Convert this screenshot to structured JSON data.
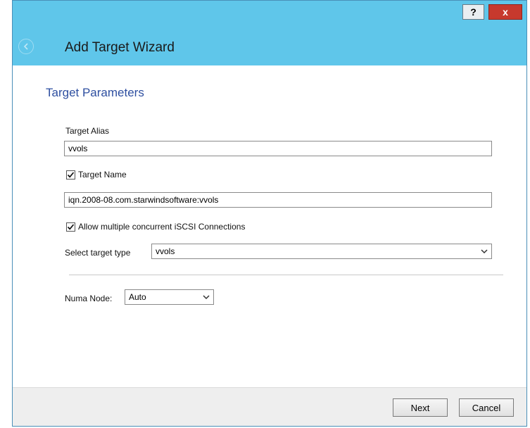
{
  "window": {
    "title": "Add Target Wizard",
    "help_label": "?",
    "close_label": "x",
    "title_bar_color": "#5fc6ea"
  },
  "page": {
    "heading": "Target Parameters"
  },
  "form": {
    "target_alias_label": "Target Alias",
    "target_alias_value": "vvols",
    "target_name_label": "Target Name",
    "target_name_checked": true,
    "target_name_value": "iqn.2008-08.com.starwindsoftware:vvols",
    "allow_multiple_label": "Allow multiple concurrent iSCSI Connections",
    "allow_multiple_checked": true,
    "target_type_label": "Select target type",
    "target_type_value": "vvols",
    "numa_node_label": "Numa Node:",
    "numa_node_value": "Auto"
  },
  "buttons": {
    "next_label": "Next",
    "cancel_label": "Cancel"
  },
  "icons": {
    "back": "back-arrow-icon",
    "checkmark": "checkmark-icon",
    "dropdown": "chevron-down-icon"
  }
}
